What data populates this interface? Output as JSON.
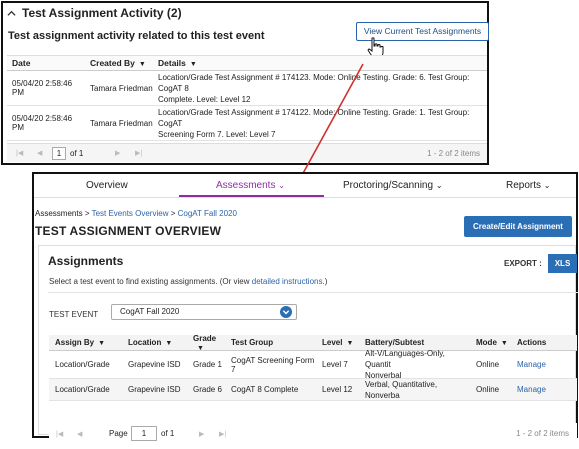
{
  "activity": {
    "header": "Test Assignment Activity (2)",
    "subtitle": "Test assignment activity related to this test event",
    "view_button": "View Current Test Assignments",
    "columns": [
      "Date",
      "Created By",
      "Details"
    ],
    "rows": [
      {
        "date": "05/04/20 2:58:46 PM",
        "created_by": "Tamara Friedman",
        "details_1": "Location/Grade Test Assignment # 174123. Mode: Online Testing. Grade: 6. Test Group: CogAT 8",
        "details_2": "Complete. Level: Level 12"
      },
      {
        "date": "05/04/20 2:58:46 PM",
        "created_by": "Tamara Friedman",
        "details_1": "Location/Grade Test Assignment # 174122. Mode: Online Testing. Grade: 1. Test Group: CogAT",
        "details_2": "Screening Form 7. Level: Level 7"
      }
    ],
    "pager": {
      "page": "1",
      "of": "of 1",
      "range": "1 - 2 of 2 items"
    }
  },
  "nav": {
    "overview": "Overview",
    "assessments": "Assessments",
    "proctoring": "Proctoring/Scanning",
    "reports": "Reports"
  },
  "breadcrumb": {
    "c1": "Assessments",
    "sep": ">",
    "c2": "Test Events Overview",
    "c3": "CogAT Fall 2020"
  },
  "page_title": "TEST ASSIGNMENT OVERVIEW",
  "create_button": "Create/Edit Assignment",
  "assignments": {
    "title": "Assignments",
    "export_label": "EXPORT :",
    "xls_button": "XLS",
    "hint_before": "Select a test event to find existing assignments. (Or view ",
    "hint_link": "detailed instructions",
    "hint_after": ".)",
    "test_event_label": "TEST EVENT",
    "test_event_value": "CogAT Fall 2020",
    "columns": [
      "Assign By",
      "Location",
      "Grade",
      "Test Group",
      "Level",
      "Battery/Subtest",
      "Mode",
      "Actions"
    ],
    "rows": [
      {
        "assign_by": "Location/Grade",
        "location": "Grapevine ISD",
        "grade": "Grade 1",
        "test_group": "CogAT Screening Form 7",
        "level": "Level 7",
        "battery_1": "Alt-V/Languages-Only, Quantit",
        "battery_2": "Nonverbal",
        "mode": "Online",
        "action": "Manage"
      },
      {
        "assign_by": "Location/Grade",
        "location": "Grapevine ISD",
        "grade": "Grade 6",
        "test_group": "CogAT 8 Complete",
        "level": "Level 12",
        "battery_1": "Verbal, Quantitative, Nonverba",
        "battery_2": "",
        "mode": "Online",
        "action": "Manage"
      }
    ],
    "pager": {
      "label": "Page",
      "page": "1",
      "of": "of 1",
      "range": "1 - 2 of 2 items"
    }
  },
  "colors": {
    "accent": "#2a6fb5",
    "nav_active": "#8b2fa8",
    "arrow": "#d03030"
  }
}
